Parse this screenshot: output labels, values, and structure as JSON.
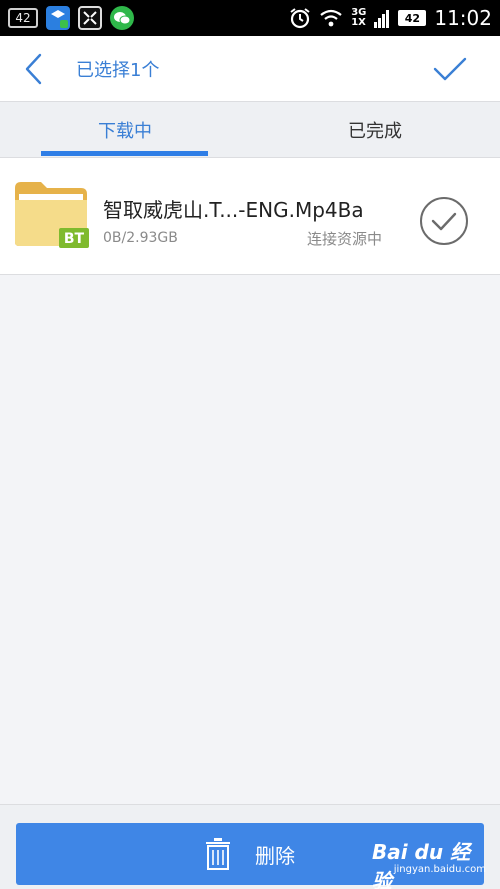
{
  "status_bar": {
    "notification_count": "42",
    "network_type_top": "3G",
    "network_type_bottom": "1X",
    "battery": "42",
    "time": "11:02"
  },
  "header": {
    "title": "已选择1个",
    "back_icon": "chevron-left-icon",
    "confirm_icon": "check-icon",
    "accent_color": "#3a7fd5"
  },
  "tabs": [
    {
      "label": "下载中",
      "active": true
    },
    {
      "label": "已完成",
      "active": false
    }
  ],
  "downloads": [
    {
      "name": "智取威虎山.T...-ENG.Mp4Ba",
      "size": "0B/2.93GB",
      "status": "连接资源中",
      "badge": "BT",
      "selected": true
    }
  ],
  "footer": {
    "delete_label": "删除",
    "button_color": "#3f86e6"
  },
  "watermark": {
    "logo": "Bai du 经验",
    "url": "jingyan.baidu.com"
  }
}
